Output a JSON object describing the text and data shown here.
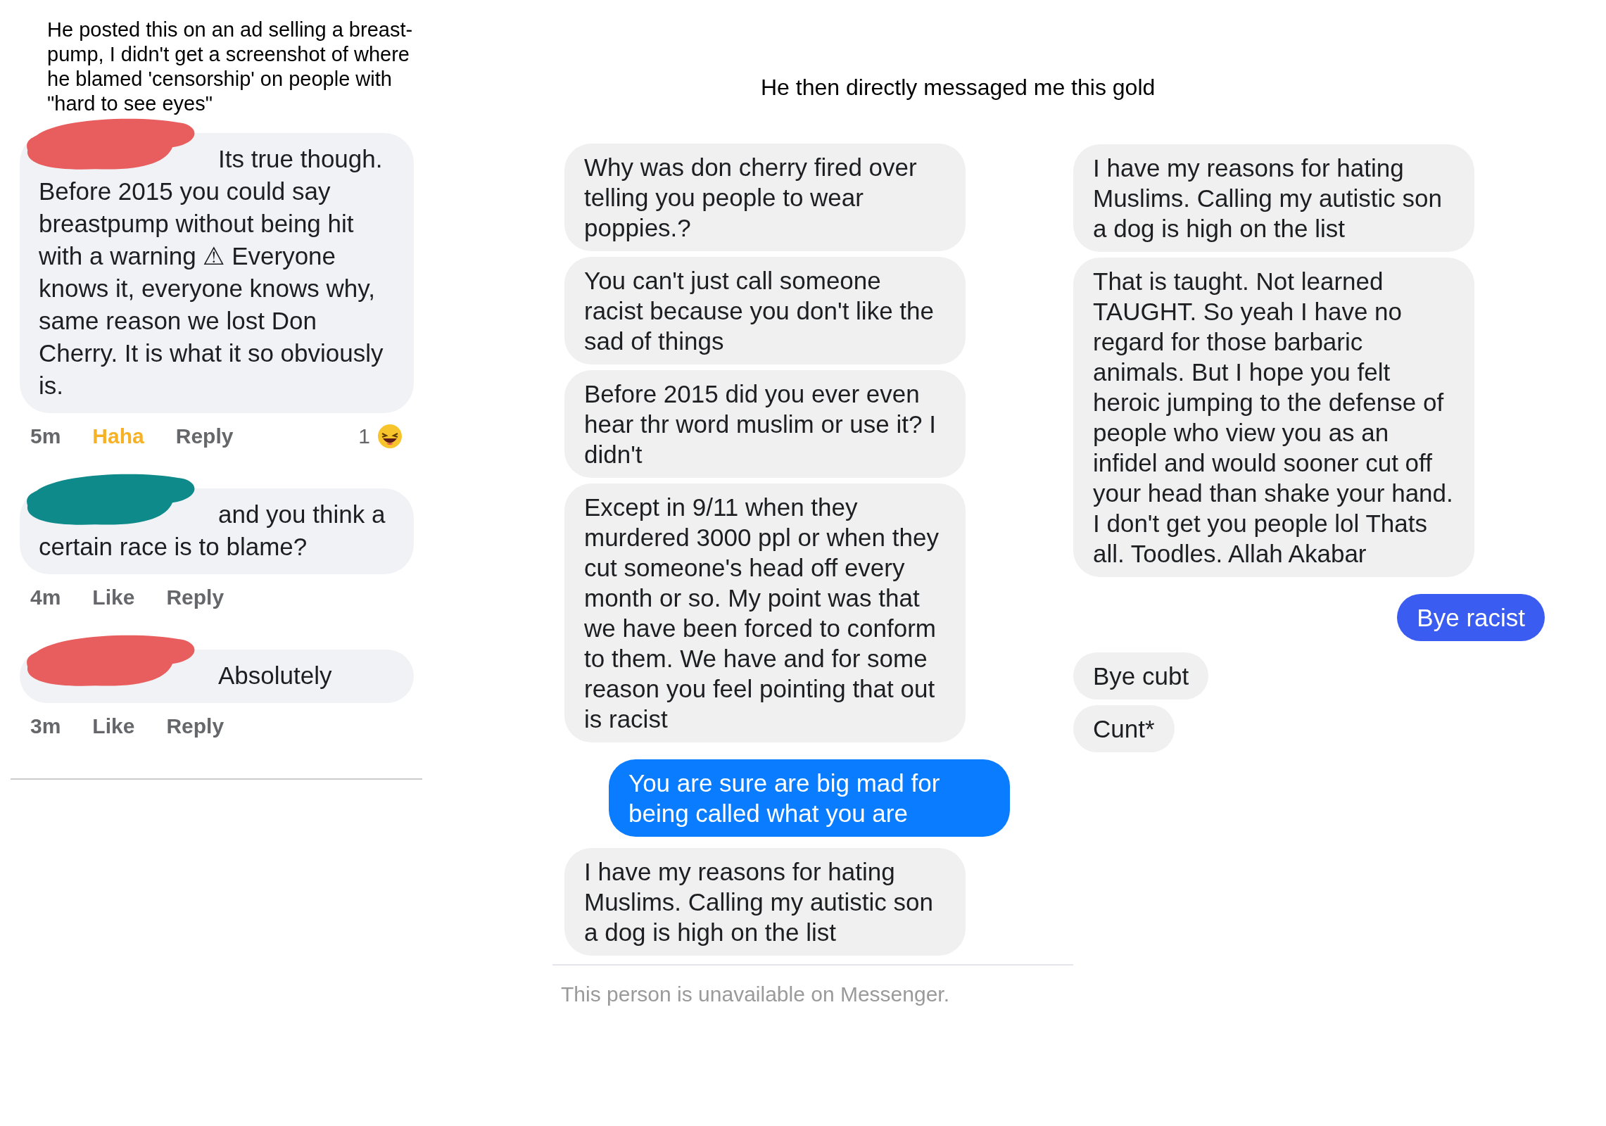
{
  "left_caption": "He posted this on an ad selling a breast-pump, I didn't get a screenshot of where he blamed 'censorship' on people with \"hard to see eyes\"",
  "comments": [
    {
      "text": "Its true though. Before 2015 you could say breastpump without being hit with a warning ⚠ Everyone knows it, everyone knows why, same reason we lost Don Cherry. It is what it so obviously is.",
      "color": "#e85d5d",
      "time": "5m",
      "reaction": {
        "label": "Haha",
        "selected": true
      },
      "reply": "Reply",
      "count": "1"
    },
    {
      "text": "and you think a certain race is to blame?",
      "color": "#0e8a8a",
      "time": "4m",
      "reaction": {
        "label": "Like",
        "selected": false
      },
      "reply": "Reply"
    },
    {
      "text": "Absolutely",
      "color": "#e85d5d",
      "time": "3m",
      "reaction": {
        "label": "Like",
        "selected": false
      },
      "reply": "Reply"
    }
  ],
  "messenger": {
    "caption": "He then directly messaged me this gold",
    "columns": [
      [
        {
          "text": "Why was don cherry fired over telling you people to wear poppies.?",
          "from_me": false
        },
        {
          "text": "You can't just call someone racist because you don't like the sad of things",
          "from_me": false
        },
        {
          "text": "Before 2015 did you ever even hear thr word muslim or use it? I didn't",
          "from_me": false
        },
        {
          "text": "Except in 9/11 when they murdered 3000 ppl or when they cut someone's head off every month or so. My point was that we have been forced to conform to them. We have and for some reason you feel pointing that out is racist",
          "from_me": false
        },
        {
          "text": "You are sure are big mad for being called what you are",
          "from_me": true
        },
        {
          "text": "I have my reasons for hating Muslims. Calling my autistic son a dog is high on the list",
          "from_me": false
        }
      ],
      [
        {
          "text": "I have my reasons for hating Muslims. Calling my autistic son a dog is high on the list",
          "from_me": false
        },
        {
          "text": "That is taught. Not learned TAUGHT. So yeah I have no regard for those barbaric animals. But I hope you felt heroic jumping to the defense of people who view you as an infidel and would sooner cut off your head than shake your hand. I don't get you people lol Thats all. Toodles. Allah Akabar",
          "from_me": false
        },
        {
          "text": "Bye racist",
          "from_me": true
        },
        {
          "text": "Bye cubt",
          "from_me": false
        },
        {
          "text": "Cunt*",
          "from_me": false
        }
      ]
    ],
    "footer": "This person is unavailable on Messenger."
  }
}
